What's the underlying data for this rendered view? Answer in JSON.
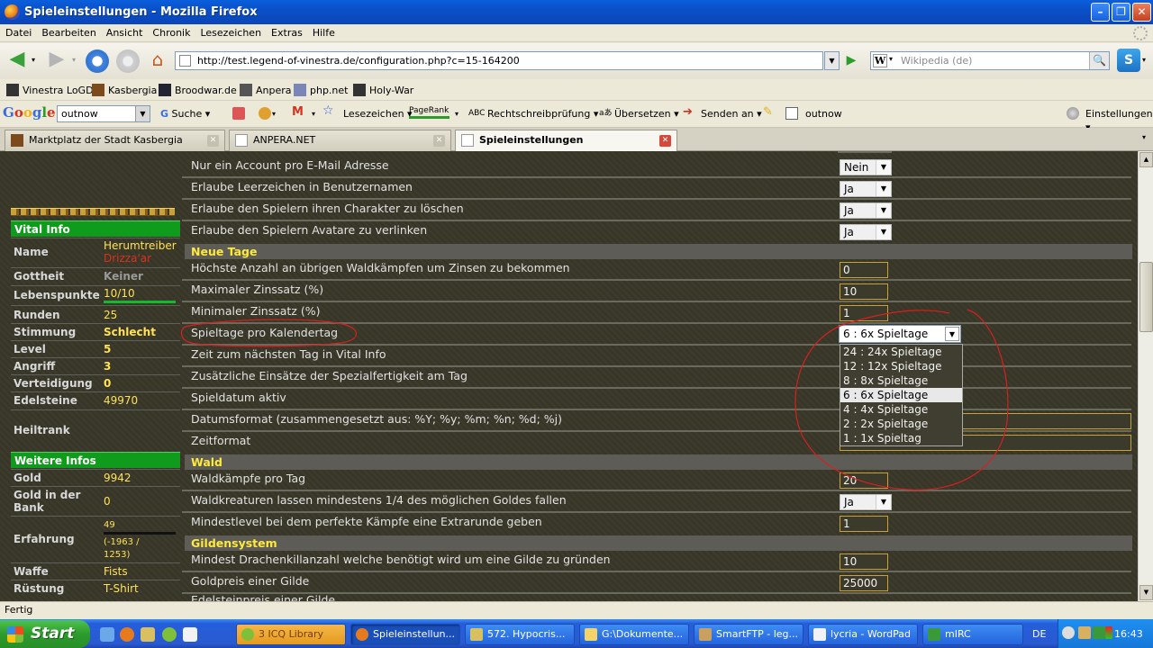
{
  "window": {
    "title": "Spieleinstellungen - Mozilla Firefox"
  },
  "menu": [
    "Datei",
    "Bearbeiten",
    "Ansicht",
    "Chronik",
    "Lesezeichen",
    "Extras",
    "Hilfe"
  ],
  "nav": {
    "url": "http://test.legend-of-vinestra.de/configuration.php?c=15-164200",
    "search_placeholder": "Wikipedia (de)"
  },
  "bookmarks": [
    "Vinestra LoGD",
    "Kasbergia",
    "Broodwar.de",
    "Anpera",
    "php.net",
    "Holy-War"
  ],
  "google": {
    "query": "outnow",
    "search": "Suche",
    "bookmarks": "Lesezeichen",
    "pagerank": "PageRank",
    "spell": "Rechtschreibprüfung",
    "translate": "Übersetzen",
    "send": "Senden an",
    "term": "outnow",
    "settings": "Einstellungen"
  },
  "tabs": [
    {
      "label": "Marktplatz der Stadt Kasbergia"
    },
    {
      "label": "ANPERA.NET"
    },
    {
      "label": "Spieleinstellungen"
    }
  ],
  "sidebar": {
    "vital_title": "Vital Info",
    "name_label": "Name",
    "name_value1": "Herumtreiber",
    "name_value2": "Drizza'ar",
    "rows": [
      {
        "k": "Gottheit",
        "v": "Keiner"
      },
      {
        "k": "Lebenspunkte",
        "v": "10/10"
      },
      {
        "k": "Runden",
        "v": "25"
      },
      {
        "k": "Stimmung",
        "v": "Schlecht"
      },
      {
        "k": "Level",
        "v": "5"
      },
      {
        "k": "Angriff",
        "v": "3"
      },
      {
        "k": "Verteidigung",
        "v": "0"
      },
      {
        "k": "Edelsteine",
        "v": "49970"
      },
      {
        "k": "Heiltrank",
        "v": ""
      }
    ],
    "more_title": "Weitere Infos",
    "rows2": [
      {
        "k": "Gold",
        "v": "9942"
      },
      {
        "k": "Gold in der Bank",
        "v": "0"
      },
      {
        "k": "Erfahrung",
        "v": "49"
      },
      {
        "k": "Waffe",
        "v": "Fists"
      },
      {
        "k": "Rüstung",
        "v": "T-Shirt"
      }
    ],
    "exp_detail1": "(-1963 /",
    "exp_detail2": "1253)",
    "hp_fraction": 1.0
  },
  "settings": {
    "r1": "Nur ein Account pro E-Mail Adresse",
    "r1v": "Nein",
    "r2": "Erlaube Leerzeichen in Benutzernamen",
    "r2v": "Ja",
    "r3": "Erlaube den Spielern ihren Charakter zu löschen",
    "r3v": "Ja",
    "r4": "Erlaube den Spielern Avatare zu verlinken",
    "r4v": "Ja",
    "sec_newday": "Neue Tage",
    "n1": "Höchste Anzahl an übrigen Waldkämpfen um Zinsen zu bekommen",
    "n1v": "0",
    "n2": "Maximaler Zinssatz (%)",
    "n2v": "10",
    "n3": "Minimaler Zinssatz (%)",
    "n3v": "1",
    "n4": "Spieltage pro Kalendertag",
    "n5": "Zeit zum nächsten Tag in Vital Info",
    "n6": "Zusätzliche Einsätze der Spezialfertigkeit am Tag",
    "n7": "Spieldatum aktiv",
    "n8": "Datumsformat (zusammengesetzt aus: %Y; %y; %m; %n; %d; %j)",
    "n9": "Zeitformat",
    "sec_forest": "Wald",
    "w1": "Waldkämpfe pro Tag",
    "w1v": "20",
    "w2": "Waldkreaturen lassen mindestens 1/4 des möglichen Goldes fallen",
    "w2v": "Ja",
    "w3": "Mindestlevel bei dem perfekte Kämpfe eine Extrarunde geben",
    "w3v": "1",
    "sec_guild": "Gildensystem",
    "g1": "Mindest Drachenkillanzahl welche benötigt wird um eine Gilde zu gründen",
    "g1v": "10",
    "g2": "Goldpreis einer Gilde",
    "g2v": "25000",
    "g3": "Edelsteinpreis einer Gilde"
  },
  "dropdown": {
    "selected": "6 : 6x Spieltage",
    "options": [
      "24 : 24x Spieltage",
      "12 : 12x Spieltage",
      "8 : 8x Spieltage",
      "6 : 6x Spieltage",
      "4 : 4x Spieltage",
      "2 : 2x Spieltage",
      "1 : 1x Spieltag"
    ]
  },
  "status": "Fertig",
  "taskbar": {
    "start": "Start",
    "tasks": [
      "3 ICQ Library",
      "Spieleinstellun...",
      "572. Hypocris...",
      "G:\\Dokumente...",
      "SmartFTP - leg...",
      "lycria - WordPad",
      "mIRC"
    ],
    "lang": "DE",
    "clock": "16:43"
  }
}
